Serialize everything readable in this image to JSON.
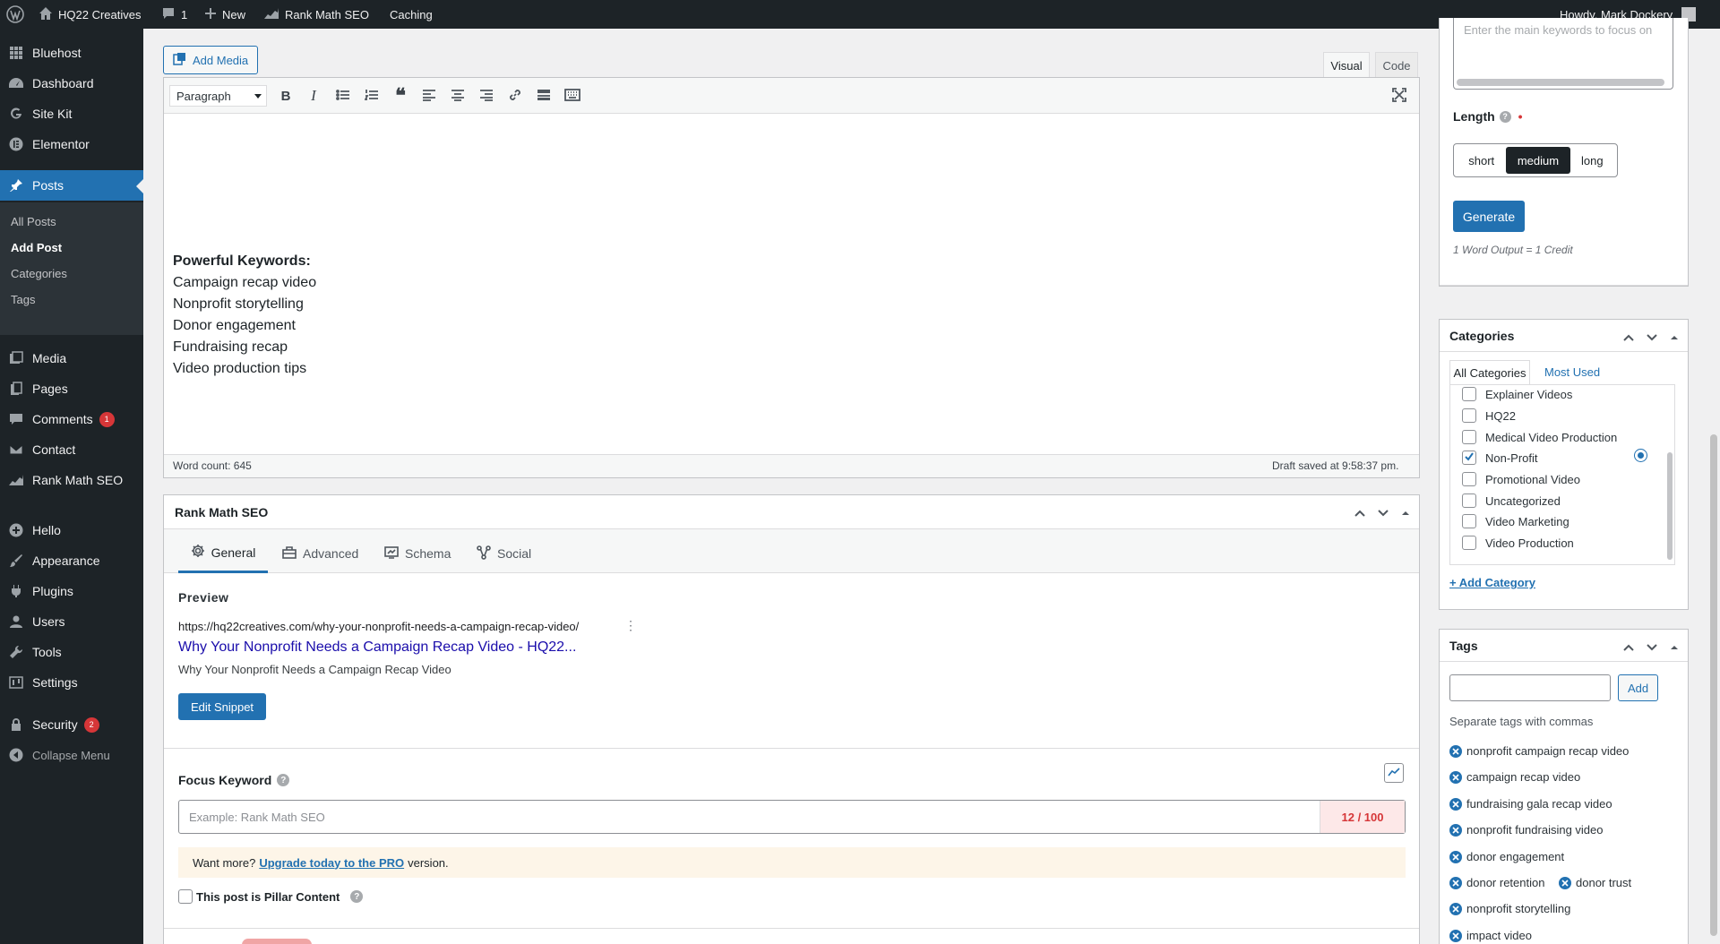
{
  "admin_bar": {
    "site_name": "HQ22 Creatives",
    "comments_count": "1",
    "new_label": "New",
    "rank_math": "Rank Math SEO",
    "caching": "Caching",
    "howdy": "Howdy, Mark Dockery"
  },
  "sidebar": {
    "items": [
      {
        "label": "Bluehost",
        "icon": "grid-icon"
      },
      {
        "label": "Dashboard",
        "icon": "gauge-icon"
      },
      {
        "label": "Site Kit",
        "icon": "google-g-icon"
      },
      {
        "label": "Elementor",
        "icon": "elementor-icon"
      },
      {
        "label": "Posts",
        "icon": "pin-icon"
      },
      {
        "label": "Media",
        "icon": "media-icon"
      },
      {
        "label": "Pages",
        "icon": "pages-icon"
      },
      {
        "label": "Comments",
        "icon": "comment-icon",
        "badge": "1"
      },
      {
        "label": "Contact",
        "icon": "mail-icon"
      },
      {
        "label": "Rank Math SEO",
        "icon": "chart-icon"
      },
      {
        "label": "Hello",
        "icon": "plus-circle-icon"
      },
      {
        "label": "Appearance",
        "icon": "brush-icon"
      },
      {
        "label": "Plugins",
        "icon": "plug-icon"
      },
      {
        "label": "Users",
        "icon": "user-icon"
      },
      {
        "label": "Tools",
        "icon": "wrench-icon"
      },
      {
        "label": "Settings",
        "icon": "sliders-icon"
      },
      {
        "label": "Security",
        "icon": "lock-icon",
        "badge": "2"
      },
      {
        "label": "Collapse Menu",
        "icon": "collapse-icon"
      }
    ],
    "posts_submenu": [
      "All Posts",
      "Add Post",
      "Categories",
      "Tags"
    ]
  },
  "editor": {
    "add_media": "Add Media",
    "tab_visual": "Visual",
    "tab_code": "Code",
    "format_select": "Paragraph",
    "content": {
      "heading": "Powerful Keywords:",
      "lines": [
        "Campaign recap video",
        "Nonprofit storytelling",
        "Donor engagement",
        "Fundraising recap",
        "Video production tips"
      ]
    },
    "word_count": "Word count: 645",
    "draft_saved": "Draft saved at 9:58:37 pm."
  },
  "rank_math": {
    "title": "Rank Math SEO",
    "tabs": [
      "General",
      "Advanced",
      "Schema",
      "Social"
    ],
    "preview_label": "Preview",
    "preview_url": "https://hq22creatives.com/why-your-nonprofit-needs-a-campaign-recap-video/",
    "preview_title": "Why Your Nonprofit Needs a Campaign Recap Video - HQ22...",
    "preview_desc": "Why Your Nonprofit Needs a Campaign Recap Video",
    "edit_snippet": "Edit Snippet",
    "focus_keyword_label": "Focus Keyword",
    "focus_keyword_placeholder": "Example: Rank Math SEO",
    "score": "12 / 100",
    "pro_prefix": "Want more?",
    "pro_link": "Upgrade today to the PRO",
    "pro_suffix": "version.",
    "pillar_label": "This post is Pillar Content"
  },
  "ai_box": {
    "keywords_placeholder": "Enter the main keywords to focus on",
    "length_label": "Length",
    "length_options": [
      "short",
      "medium",
      "long"
    ],
    "selected_length": "medium",
    "generate": "Generate",
    "credit_note": "1 Word Output = 1 Credit"
  },
  "categories": {
    "title": "Categories",
    "tab_all": "All Categories",
    "tab_most": "Most Used",
    "items": [
      {
        "label": "Explainer Videos",
        "checked": false
      },
      {
        "label": "HQ22",
        "checked": false
      },
      {
        "label": "Medical Video Production",
        "checked": false
      },
      {
        "label": "Non-Profit",
        "checked": true
      },
      {
        "label": "Promotional Video",
        "checked": false
      },
      {
        "label": "Uncategorized",
        "checked": false
      },
      {
        "label": "Video Marketing",
        "checked": false
      },
      {
        "label": "Video Production",
        "checked": false
      }
    ],
    "add_link": "+ Add Category"
  },
  "tags": {
    "title": "Tags",
    "add_button": "Add",
    "hint": "Separate tags with commas",
    "items": [
      "nonprofit campaign recap video",
      "campaign recap video",
      "fundraising gala recap video",
      "nonprofit fundraising video",
      "donor engagement",
      "donor retention",
      "donor trust",
      "nonprofit storytelling",
      "impact video"
    ]
  },
  "colors": {
    "accent": "#2271b1",
    "adminbar": "#1d2327",
    "danger": "#d63638"
  }
}
